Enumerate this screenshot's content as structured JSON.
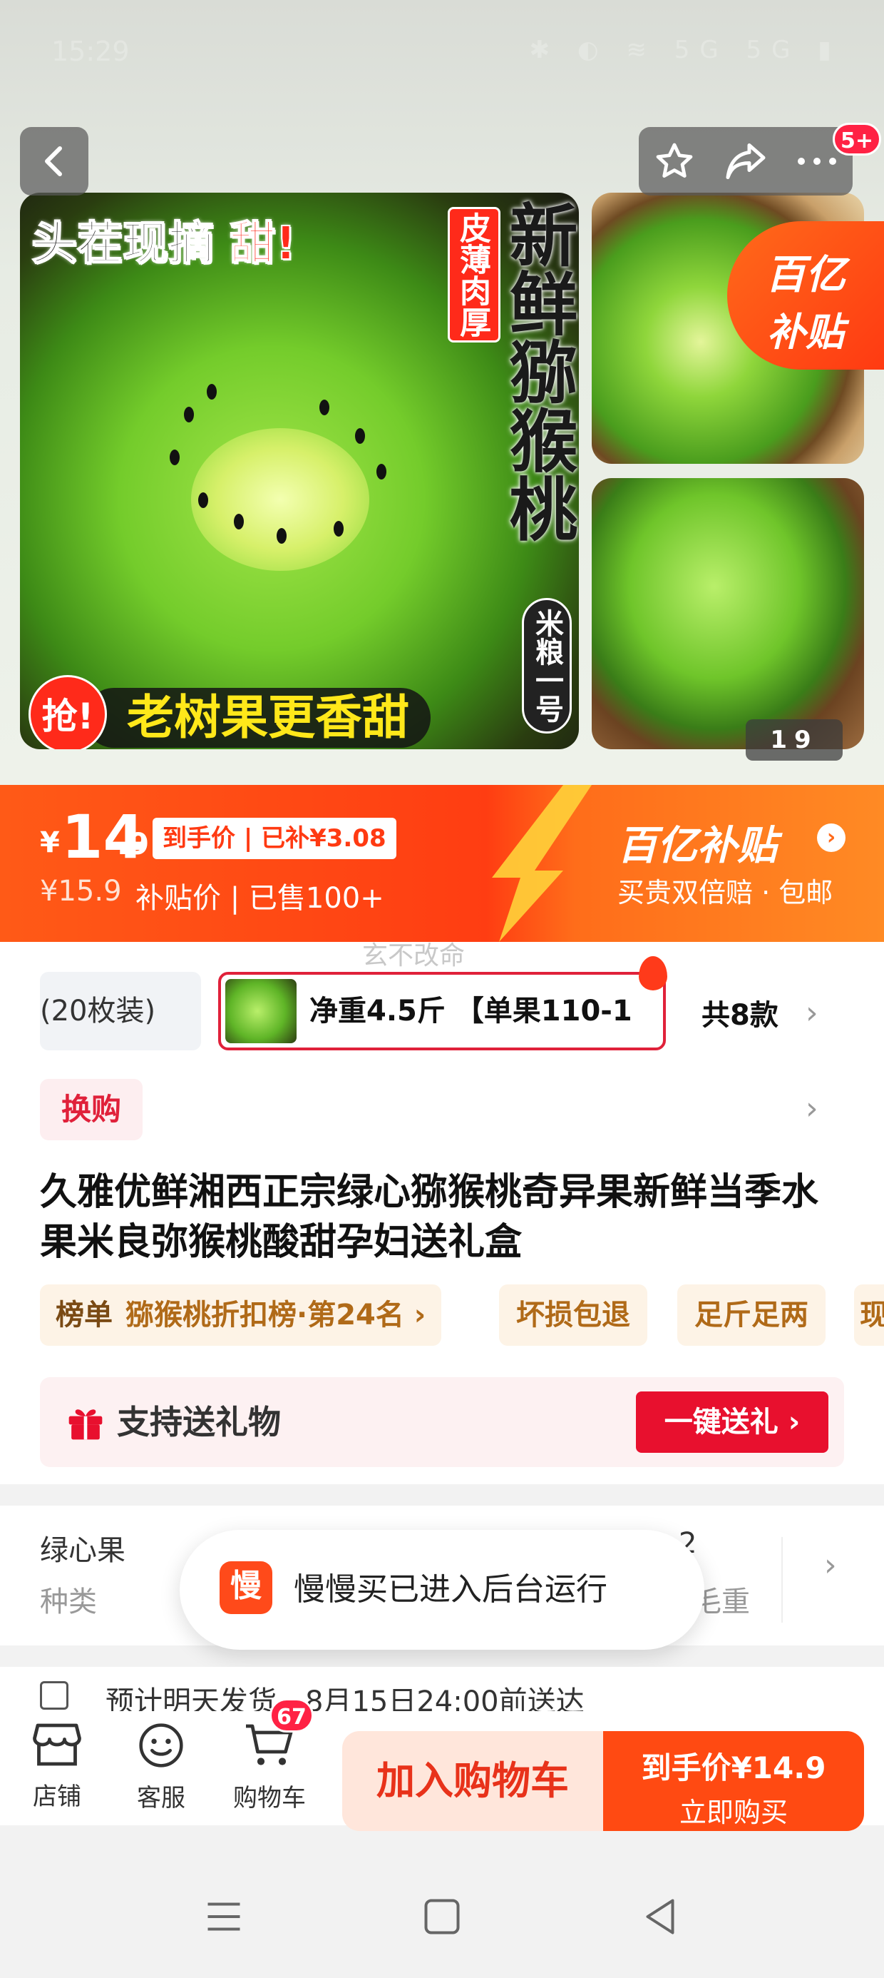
{
  "status_bar": {
    "time": "15:29",
    "icons_text": "✱ ◐ ≋ 5G 5G ▮"
  },
  "gallery": {
    "badge_count": "5+",
    "slogan_prefix": "头茬现摘",
    "slogan_red": "甜!",
    "tag_red": "皮薄肉厚",
    "vertical_title": "新鲜猕猴桃",
    "vertical_brand": "米粮一号",
    "grab_badge": "抢!",
    "grab_text": "老树果更香甜",
    "sticker_line1": "百亿",
    "sticker_line2": "补贴",
    "page_current": "1",
    "page_total": "9"
  },
  "price": {
    "currency": "¥",
    "integer": "14",
    "decimal": ".9",
    "pill": "到手价 | 已补¥3.08",
    "original": "¥15.9",
    "subsidy_sold": "补贴价 | 已售100+",
    "yi_title": "百亿补贴",
    "yi_arrow": "›",
    "yi_sub": "买贵双倍赔 · 包邮"
  },
  "watermark": "玄不改命",
  "sku": {
    "chip1": "(20枚装)",
    "chip2": "净重4.5斤 【单果110-1",
    "total": "共8款"
  },
  "swap_tag": "换购",
  "product_title": "久雅优鲜湘西正宗绿心猕猴桃奇异果新鲜当季水果米良弥猴桃酸甜孕妇送礼盒",
  "tags": {
    "rank_label": "榜单",
    "rank_value": "猕猴桃折扣榜·第24名 ›",
    "chip_damage": "坏损包退",
    "chip_weight": "足斤足两",
    "chip_cut": "现"
  },
  "gift": {
    "label": "支持送礼物",
    "button": "一键送礼 ›"
  },
  "attrs": {
    "v1": "绿心果",
    "k1": "种类",
    "v2": "2",
    "k2": "毛重"
  },
  "toast": {
    "app_icon": "慢",
    "text": "慢慢买已进入后台运行"
  },
  "shipping": {
    "text": "预计明天发货，8月15日24:00前送达"
  },
  "bottom": {
    "shop": "店铺",
    "service": "客服",
    "cart": "购物车",
    "cart_count": "67",
    "add_cart": "加入购物车",
    "buy_line1": "到手价¥14.9",
    "buy_line2": "立即购买"
  },
  "colors": {
    "accent": "#ff4a12",
    "brand_red": "#e8102e",
    "kiwi_green": "#74cc2b"
  }
}
